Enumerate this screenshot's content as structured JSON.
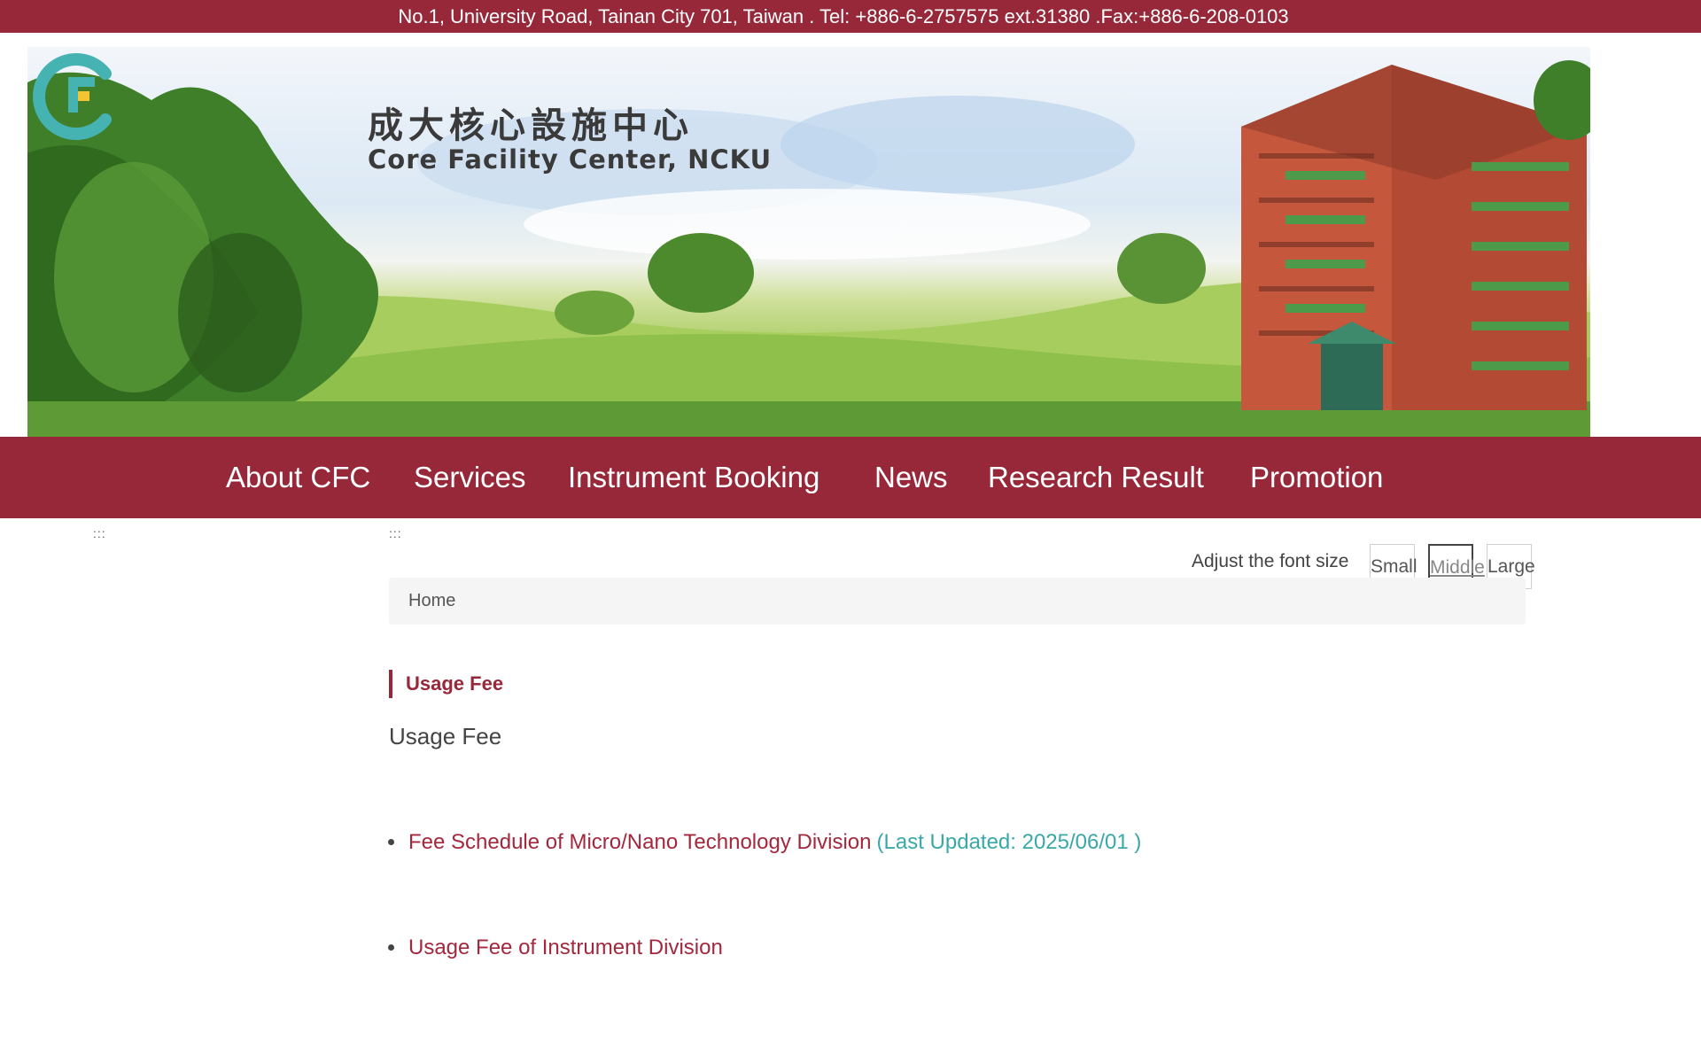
{
  "topbar": {
    "address": "No.1, University Road, Tainan City 701, Taiwan . Tel: +886-6-2757575 ext.31380 .Fax:+886-6-208-0103"
  },
  "header": {
    "logo_cn": "成大核心設施中心",
    "logo_en": "Core Facility Center, NCKU"
  },
  "nav": {
    "items": [
      {
        "label": "About CFC"
      },
      {
        "label": "Services"
      },
      {
        "label": "Instrument Booking"
      },
      {
        "label": "News"
      },
      {
        "label": "Research Result"
      },
      {
        "label": "Promotion"
      }
    ]
  },
  "accesskeys": {
    "left": ":::",
    "main": ":::"
  },
  "font_size": {
    "label": "Adjust the font size",
    "small": "Small",
    "middle": "Middle",
    "large": "Large",
    "selected": "Middle"
  },
  "breadcrumb": {
    "home": "Home"
  },
  "content": {
    "section_title": "Usage Fee",
    "heading": "Usage Fee",
    "items": [
      {
        "link": "Fee Schedule of Micro/Nano Technology Division",
        "note": "(Last Updated: 2025/06/01 )"
      },
      {
        "link": "Usage Fee of Instrument Division",
        "note": ""
      }
    ]
  },
  "colors": {
    "brand": "#96283a",
    "link": "#a3283d",
    "note": "#3aa8a8",
    "logo_teal": "#46b3b3",
    "logo_yellow": "#f4c431"
  }
}
